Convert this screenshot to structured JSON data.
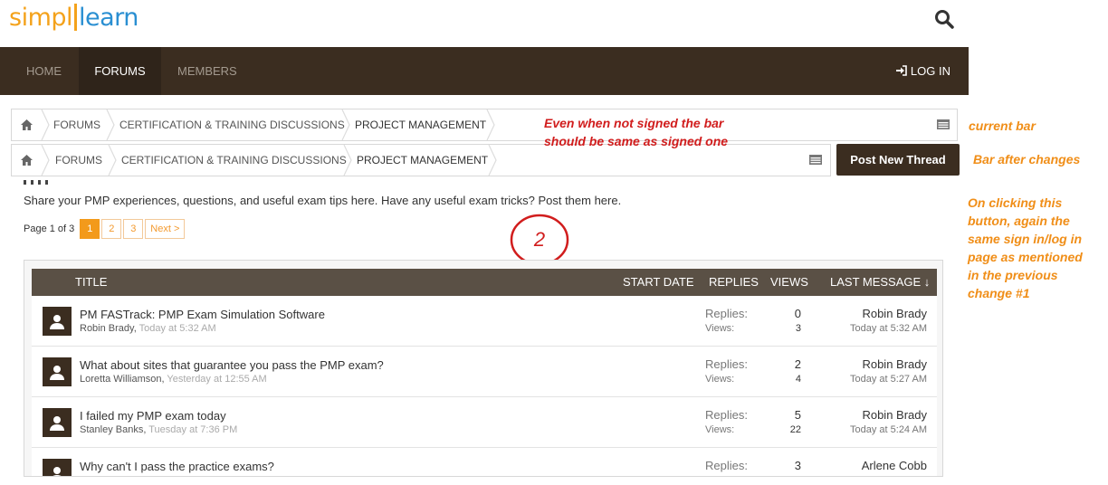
{
  "header": {
    "logo": {
      "part1": "simpl",
      "part2": "learn"
    },
    "nav": [
      {
        "label": "HOME",
        "active": false
      },
      {
        "label": "FORUMS",
        "active": true
      },
      {
        "label": "MEMBERS",
        "active": false
      }
    ],
    "login_label": "LOG IN"
  },
  "breadcrumb_current": [
    "FORUMS",
    "CERTIFICATION & TRAINING DISCUSSIONS",
    "PROJECT MANAGEMENT"
  ],
  "breadcrumb_changed": [
    "FORUMS",
    "CERTIFICATION & TRAINING DISCUSSIONS",
    "PROJECT MANAGEMENT"
  ],
  "post_new_thread_label": "Post New Thread",
  "annotations": {
    "red_note": "Even when not signed the bar should be same as signed one",
    "current_bar": "current bar",
    "bar_after_changes": "Bar after changes",
    "click_note": "On clicking this button, again the same sign in/log in page as mentioned in the previous change #1",
    "circle_number": "2"
  },
  "forum": {
    "description": "Share your PMP experiences, questions, and useful exam tips here. Have any useful exam tricks? Post them here.",
    "page_info": "Page 1 of 3",
    "pages": [
      "1",
      "2",
      "3"
    ],
    "next_label": "Next >"
  },
  "table": {
    "headers": {
      "title": "TITLE",
      "start_date": "START DATE",
      "replies": "REPLIES",
      "views": "VIEWS",
      "last_message": "LAST MESSAGE ↓"
    },
    "replies_label": "Replies:",
    "views_label": "Views:",
    "rows": [
      {
        "title": "PM FASTrack: PMP Exam Simulation Software",
        "author": "Robin Brady,",
        "date": "Today at 5:32 AM",
        "replies": "0",
        "views": "3",
        "last_user": "Robin Brady",
        "last_date": "Today at 5:32 AM"
      },
      {
        "title": "What about sites that guarantee you pass the PMP exam?",
        "author": "Loretta Williamson,",
        "date": "Yesterday at 12:55 AM",
        "replies": "2",
        "views": "4",
        "last_user": "Robin Brady",
        "last_date": "Today at 5:27 AM"
      },
      {
        "title": "I failed my PMP exam today",
        "author": "Stanley Banks,",
        "date": "Tuesday at 7:36 PM",
        "replies": "5",
        "views": "22",
        "last_user": "Robin Brady",
        "last_date": "Today at 5:24 AM"
      },
      {
        "title": "Why can't I pass the practice exams?",
        "author": "",
        "date": "",
        "replies": "3",
        "views": "",
        "last_user": "Arlene Cobb",
        "last_date": ""
      }
    ]
  }
}
